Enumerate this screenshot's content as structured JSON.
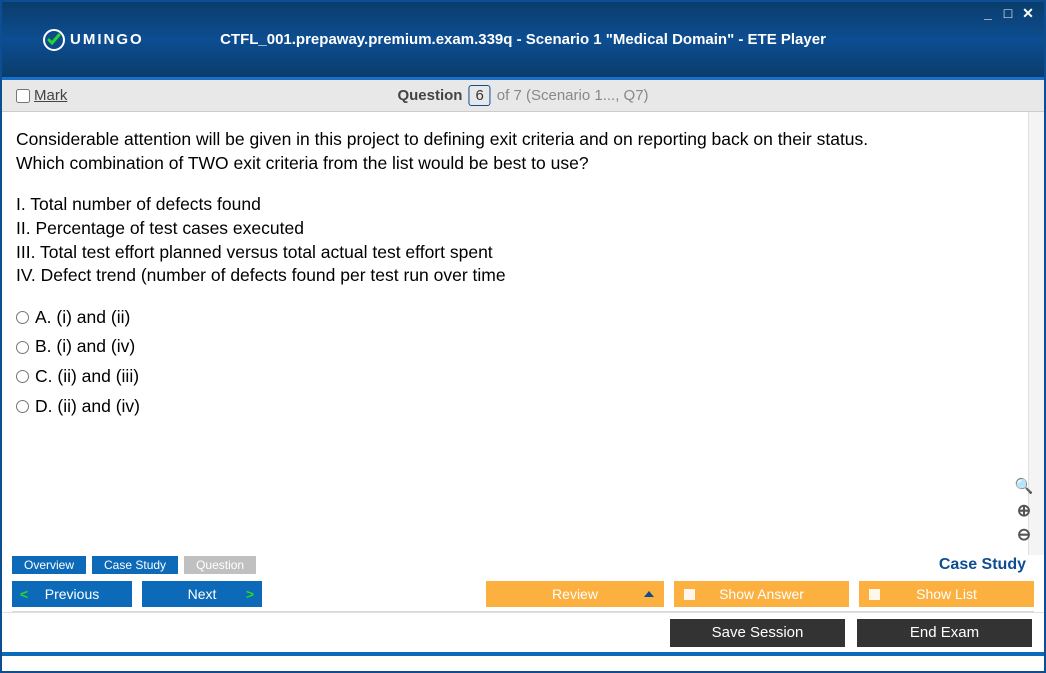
{
  "window": {
    "title": "CTFL_001.prepaway.premium.exam.339q - Scenario 1 \"Medical Domain\" - ETE Player",
    "logo_text": "UMINGO"
  },
  "question_bar": {
    "mark_label": "Mark",
    "question_word": "Question",
    "current_number": "6",
    "suffix": "of 7 (Scenario 1..., Q7)"
  },
  "question": {
    "stem_line1": "Considerable attention will be given in this project to defining exit criteria and on reporting back on their status.",
    "stem_line2": "Which combination of TWO exit criteria from the list would be best to use?",
    "roman": {
      "i": "I. Total number of defects found",
      "ii": "II. Percentage of test cases executed",
      "iii": "III. Total test effort planned versus total actual test effort spent",
      "iv": "IV. Defect trend (number of defects found per test run over time"
    },
    "answers": {
      "a": "A. (i) and (ii)",
      "b": "B. (i) and (iv)",
      "c": "C. (ii) and (iii)",
      "d": "D. (ii) and (iv)"
    }
  },
  "tabs": {
    "overview": "Overview",
    "case_study": "Case Study",
    "question": "Question",
    "right_label": "Case Study"
  },
  "buttons": {
    "previous": "Previous",
    "next": "Next",
    "review": "Review",
    "show_answer": "Show Answer",
    "show_list": "Show List",
    "save_session": "Save Session",
    "end_exam": "End Exam"
  }
}
